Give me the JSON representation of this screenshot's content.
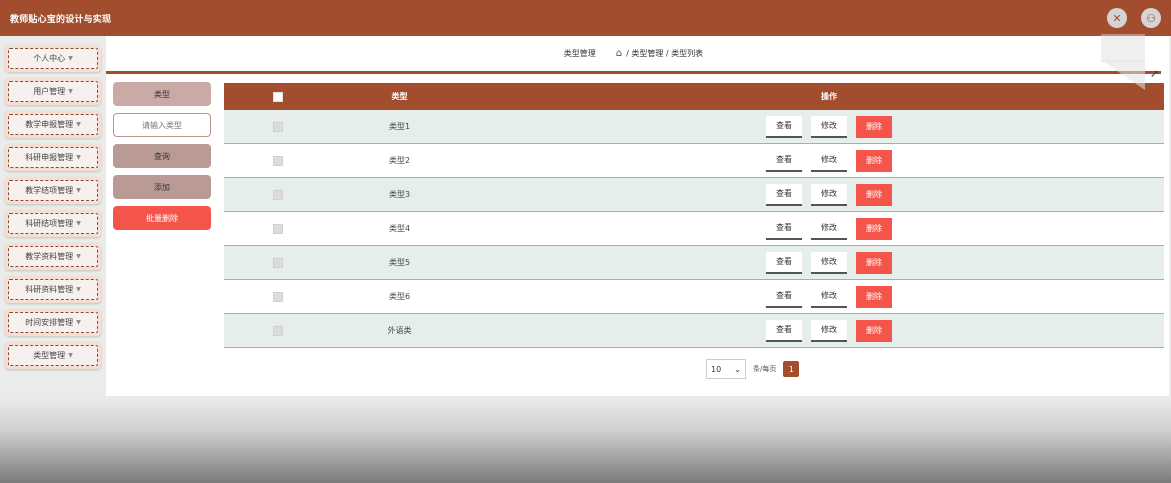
{
  "app": {
    "title": "教师贴心宝的设计与实现"
  },
  "topbar": {
    "fullscreen_icon": "close-x-icon",
    "user_icon": "user-icon"
  },
  "sidebar": {
    "items": [
      {
        "label": "个人中心"
      },
      {
        "label": "用户管理"
      },
      {
        "label": "教学申报管理"
      },
      {
        "label": "科研申报管理"
      },
      {
        "label": "教学结项管理"
      },
      {
        "label": "科研结项管理"
      },
      {
        "label": "教学资料管理"
      },
      {
        "label": "科研资料管理"
      },
      {
        "label": "时间安排管理"
      },
      {
        "label": "类型管理"
      }
    ]
  },
  "breadcrumb": {
    "current": "类型管理",
    "path": "/ 类型管理 / 类型列表"
  },
  "search": {
    "field_label": "类型",
    "placeholder": "请输入类型",
    "query_label": "查询",
    "add_label": "添加",
    "batch_delete_label": "批量删除"
  },
  "table": {
    "headers": {
      "type": "类型",
      "ops": "操作"
    },
    "rows": [
      {
        "type": "类型1"
      },
      {
        "type": "类型2"
      },
      {
        "type": "类型3"
      },
      {
        "type": "类型4"
      },
      {
        "type": "类型5"
      },
      {
        "type": "类型6"
      },
      {
        "type": "外语类"
      }
    ],
    "actions": {
      "view": "查看",
      "edit": "修改",
      "delete": "删除"
    }
  },
  "pagination": {
    "page_size": "10",
    "per_page_label": "条/每页",
    "current_page": "1"
  },
  "colors": {
    "primary": "#a24e2e",
    "danger": "#f4544a"
  }
}
